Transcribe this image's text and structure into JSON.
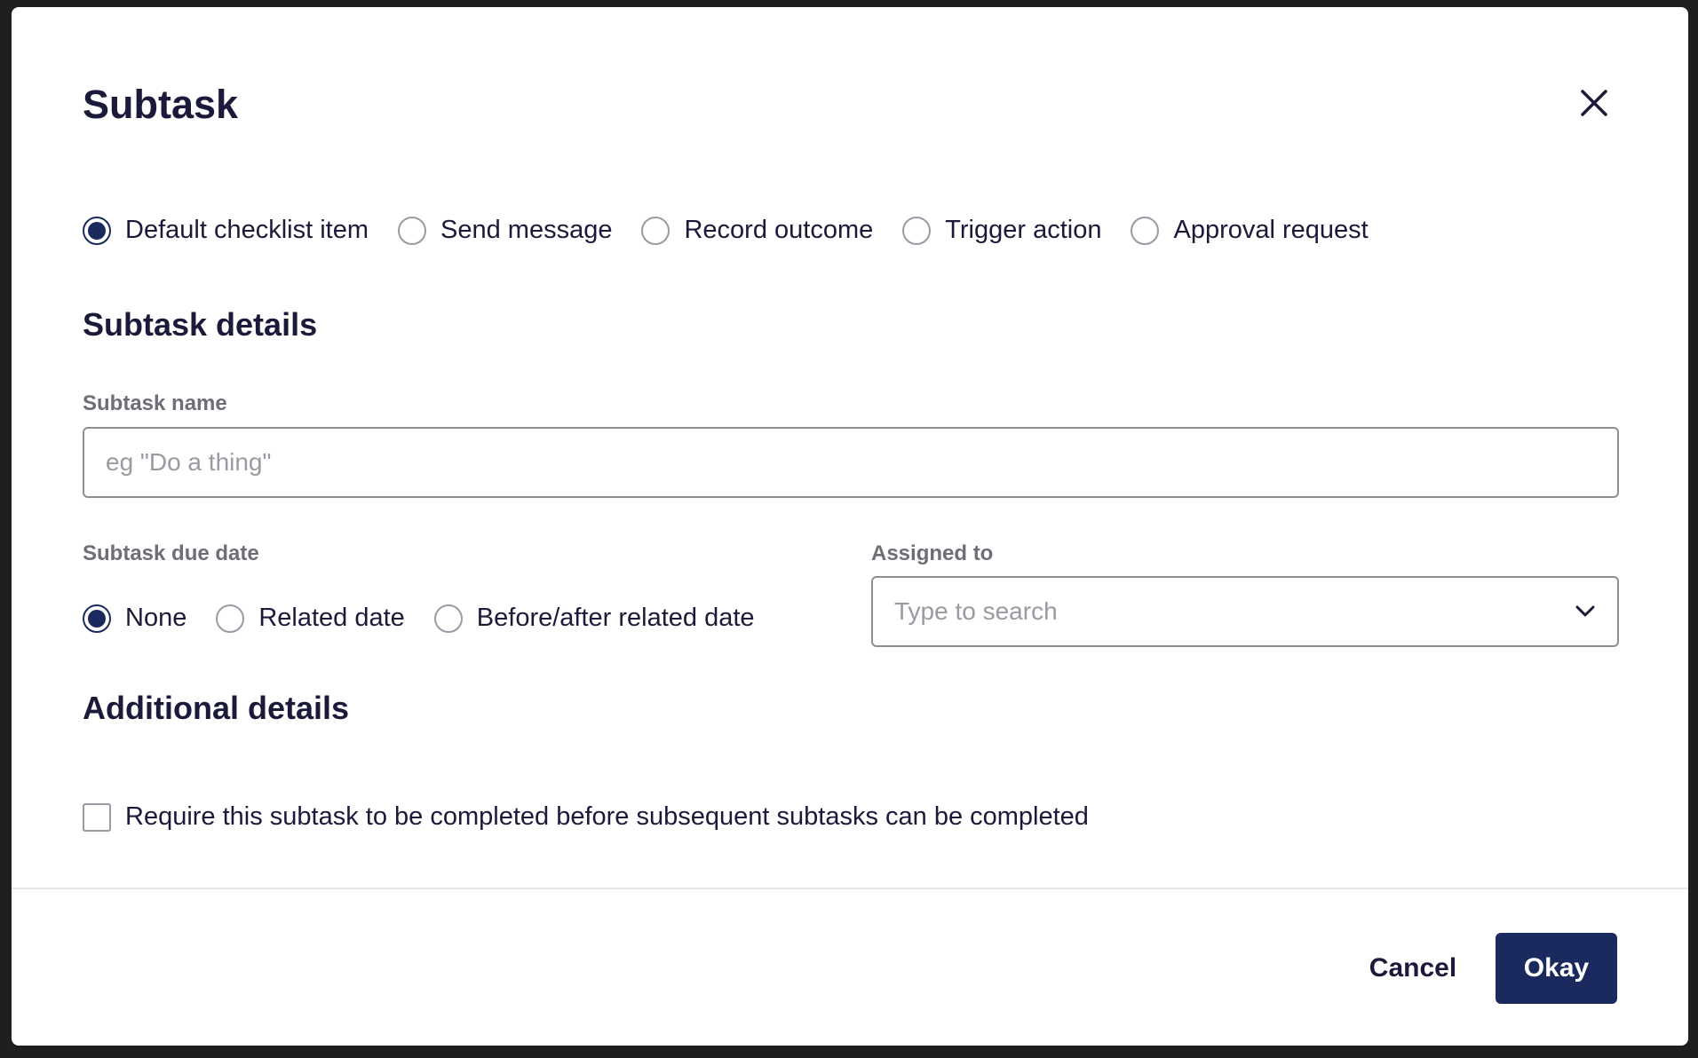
{
  "modal": {
    "title": "Subtask",
    "close_icon": "close-icon"
  },
  "subtask_type": {
    "options": [
      {
        "label": "Default checklist item",
        "checked": true
      },
      {
        "label": "Send message",
        "checked": false
      },
      {
        "label": "Record outcome",
        "checked": false
      },
      {
        "label": "Trigger action",
        "checked": false
      },
      {
        "label": "Approval request",
        "checked": false
      }
    ]
  },
  "details": {
    "heading": "Subtask details",
    "name_label": "Subtask name",
    "name_placeholder": "eg \"Do a thing\"",
    "name_value": "",
    "due_date_label": "Subtask due date",
    "due_date_options": [
      {
        "label": "None",
        "checked": true
      },
      {
        "label": "Related date",
        "checked": false
      },
      {
        "label": "Before/after related date",
        "checked": false
      }
    ],
    "assigned_label": "Assigned to",
    "assigned_placeholder": "Type to search"
  },
  "additional": {
    "heading": "Additional details",
    "require_label": "Require this subtask to be completed before subsequent subtasks can be completed",
    "require_checked": false
  },
  "footer": {
    "cancel_label": "Cancel",
    "okay_label": "Okay"
  },
  "colors": {
    "primary": "#1a2a5e",
    "text": "#1c1a3a",
    "muted": "#6e6e76"
  }
}
